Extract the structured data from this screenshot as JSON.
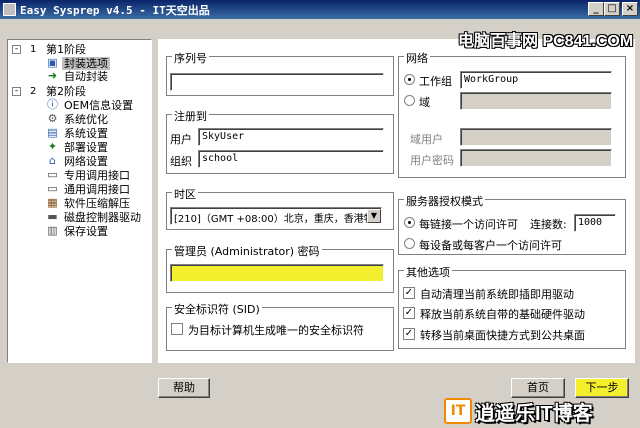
{
  "window": {
    "title": "Easy Sysprep v4.5 - IT天空出品",
    "minimize": "_",
    "maximize": "□",
    "close": "×"
  },
  "watermark_top": "电脑百事网 PC841.COM",
  "watermark_bottom": {
    "logo": "IT",
    "text": "逍遥乐IT博客"
  },
  "tree": {
    "phase1": {
      "num": "1",
      "label": "第1阶段",
      "toggle": "-"
    },
    "phase1_items": [
      "封装选项",
      "自动封装"
    ],
    "phase2": {
      "num": "2",
      "label": "第2阶段",
      "toggle": "-"
    },
    "phase2_items": [
      "OEM信息设置",
      "系统优化",
      "系统设置",
      "部署设置",
      "网络设置",
      "专用调用接口",
      "通用调用接口",
      "软件压缩解压",
      "磁盘控制器驱动",
      "保存设置"
    ]
  },
  "serial": {
    "legend": "序列号",
    "value": ""
  },
  "register": {
    "legend": "注册到",
    "user_label": "用户",
    "user_value": "SkyUser",
    "org_label": "组织",
    "org_value": "school"
  },
  "timezone": {
    "legend": "时区",
    "value": "[210]（GMT +08:00）北京，重庆，香港特"
  },
  "admin": {
    "legend": "管理员 (Administrator) 密码",
    "value": ""
  },
  "sid": {
    "legend": "安全标识符 (SID)",
    "checkbox_label": "为目标计算机生成唯一的安全标识符",
    "checked": false
  },
  "network": {
    "legend": "网络",
    "workgroup_label": "工作组",
    "workgroup_value": "WorkGroup",
    "domain_label": "域",
    "domain_value": "",
    "domain_user_label": "域用户",
    "domain_user_value": "",
    "domain_pwd_label": "用户密码",
    "domain_pwd_value": ""
  },
  "license": {
    "legend": "服务器授权模式",
    "per_server_label": "每链接一个访问许可",
    "connections_label": "连接数:",
    "connections_value": "1000",
    "per_seat_label": "每设备或每客户一个访问许可"
  },
  "other": {
    "legend": "其他选项",
    "opt1": "自动清理当前系统即插即用驱动",
    "opt2": "释放当前系统自带的基础硬件驱动",
    "opt3": "转移当前桌面快捷方式到公共桌面",
    "check_mark": "✓"
  },
  "buttons": {
    "help": "帮助",
    "home": "首页",
    "next": "下一步"
  },
  "colors": {
    "highlight": "#f4ef2e",
    "title_bar": "#0a246a"
  }
}
